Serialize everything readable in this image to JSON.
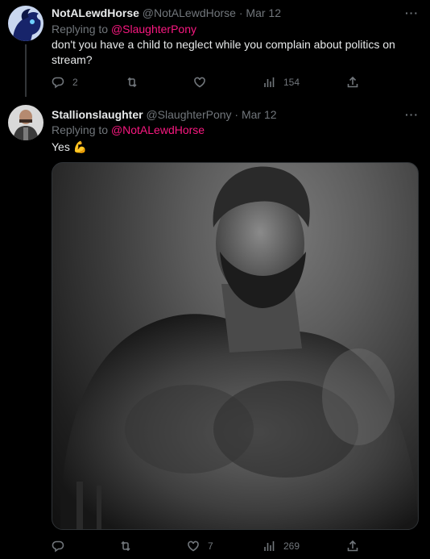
{
  "tweet1": {
    "display_name": "NotALewdHorse",
    "handle": "@NotALewdHorse",
    "date": "Mar 12",
    "more_glyph": "···",
    "replying_prefix": "Replying to ",
    "replying_to": "@SlaughterPony",
    "text": "don't you have a child to neglect while you complain about politics on stream?",
    "stats": {
      "replies": "2",
      "retweets": "",
      "likes": "",
      "views": "154"
    }
  },
  "tweet2": {
    "display_name": "Stallionslaughter",
    "handle": "@SlaughterPony",
    "date": "Mar 12",
    "more_glyph": "···",
    "replying_prefix": "Replying to ",
    "replying_to": "@NotALewdHorse",
    "text": "Yes",
    "emoji": "💪",
    "stats": {
      "replies": "",
      "retweets": "",
      "likes": "7",
      "views": "269"
    }
  },
  "icons": {
    "reply": "reply-icon",
    "retweet": "retweet-icon",
    "like": "heart-icon",
    "views": "views-icon",
    "share": "share-icon"
  },
  "colors": {
    "background": "#000000",
    "text": "#e7e9ea",
    "muted": "#71767b",
    "mention": "#f91880",
    "emoji": "#f6c337"
  }
}
